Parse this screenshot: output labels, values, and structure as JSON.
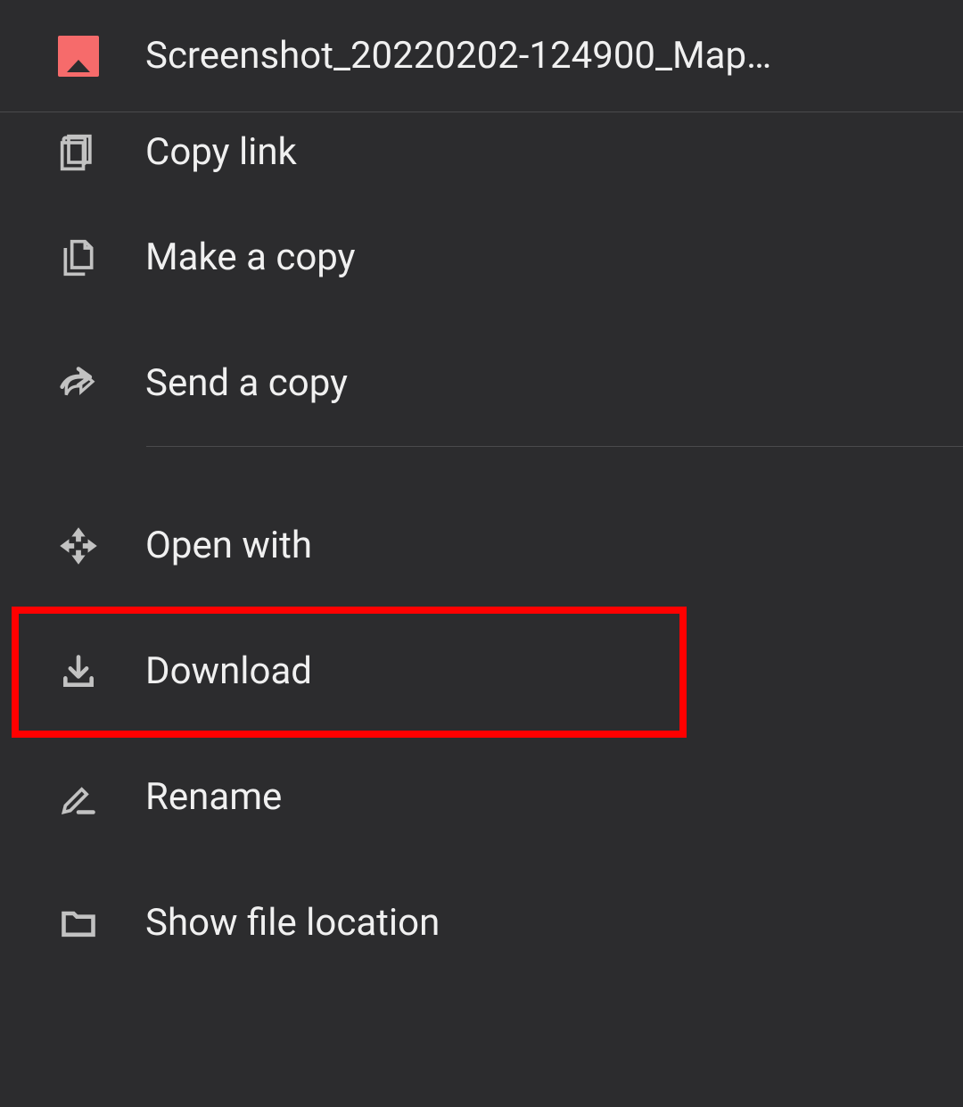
{
  "header": {
    "file_name": "Screenshot_20220202-124900_Map…"
  },
  "menu": {
    "copy_link": "Copy link",
    "make_a_copy": "Make a copy",
    "send_a_copy": "Send a copy",
    "open_with": "Open with",
    "download": "Download",
    "rename": "Rename",
    "show_file_location": "Show file location"
  },
  "highlight": {
    "target": "download"
  }
}
